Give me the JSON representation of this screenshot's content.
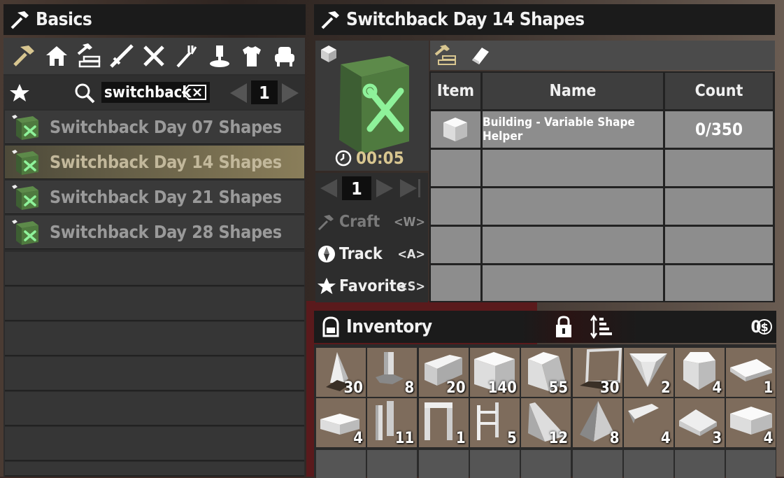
{
  "left_panel": {
    "title": "Basics",
    "categories": [
      "hammer-icon",
      "house-icon",
      "building-icon",
      "weapon-icon",
      "tools-icon",
      "fork-icon",
      "science-icon",
      "shirt-icon",
      "chair-icon"
    ],
    "search": {
      "query": "switchback",
      "page": "1"
    },
    "recipes": [
      {
        "label": "Switchback Day 07 Shapes",
        "selected": false
      },
      {
        "label": "Switchback Day 14 Shapes",
        "selected": true
      },
      {
        "label": "Switchback Day 21 Shapes",
        "selected": false
      },
      {
        "label": "Switchback Day 28 Shapes",
        "selected": false
      }
    ]
  },
  "recipe_panel": {
    "title": "Switchback Day 14 Shapes",
    "craft_time": "00:05",
    "quantity": "1",
    "actions": [
      {
        "label": "Craft",
        "hotkey": "<W>",
        "enabled": false
      },
      {
        "label": "Track",
        "hotkey": "<A>",
        "enabled": true
      },
      {
        "label": "Favorite",
        "hotkey": "<S>",
        "enabled": true
      }
    ],
    "table": {
      "headers": [
        "Item",
        "Name",
        "Count"
      ],
      "rows": [
        {
          "name": "Building - Variable Shape Helper",
          "count": "0/350"
        }
      ]
    }
  },
  "inventory": {
    "title": "Inventory",
    "currency": "0",
    "slots": [
      {
        "icon": "pyramid-shape-icon",
        "count": "30"
      },
      {
        "icon": "pillar-shape-icon",
        "count": "8"
      },
      {
        "icon": "wedge-block-icon",
        "count": "20"
      },
      {
        "icon": "cube-block-icon",
        "count": "140"
      },
      {
        "icon": "ramp-cube-icon",
        "count": "55"
      },
      {
        "icon": "frame-shape-icon",
        "count": "30"
      },
      {
        "icon": "tapered-block-icon",
        "count": "2"
      },
      {
        "icon": "octagon-block-icon",
        "count": "4"
      },
      {
        "icon": "flat-plate-icon",
        "count": "1"
      },
      {
        "icon": "half-slab-icon",
        "count": "4"
      },
      {
        "icon": "double-pillar-icon",
        "count": "11"
      },
      {
        "icon": "doorway-frame-icon",
        "count": "1"
      },
      {
        "icon": "ladder-frame-icon",
        "count": "5"
      },
      {
        "icon": "ramp-wedge-icon",
        "count": "12"
      },
      {
        "icon": "triangle-wedge-icon",
        "count": "8"
      },
      {
        "icon": "thin-wedge-icon",
        "count": "4"
      },
      {
        "icon": "slope-block-icon",
        "count": "3"
      },
      {
        "icon": "flat-cube-icon",
        "count": "4"
      }
    ]
  }
}
